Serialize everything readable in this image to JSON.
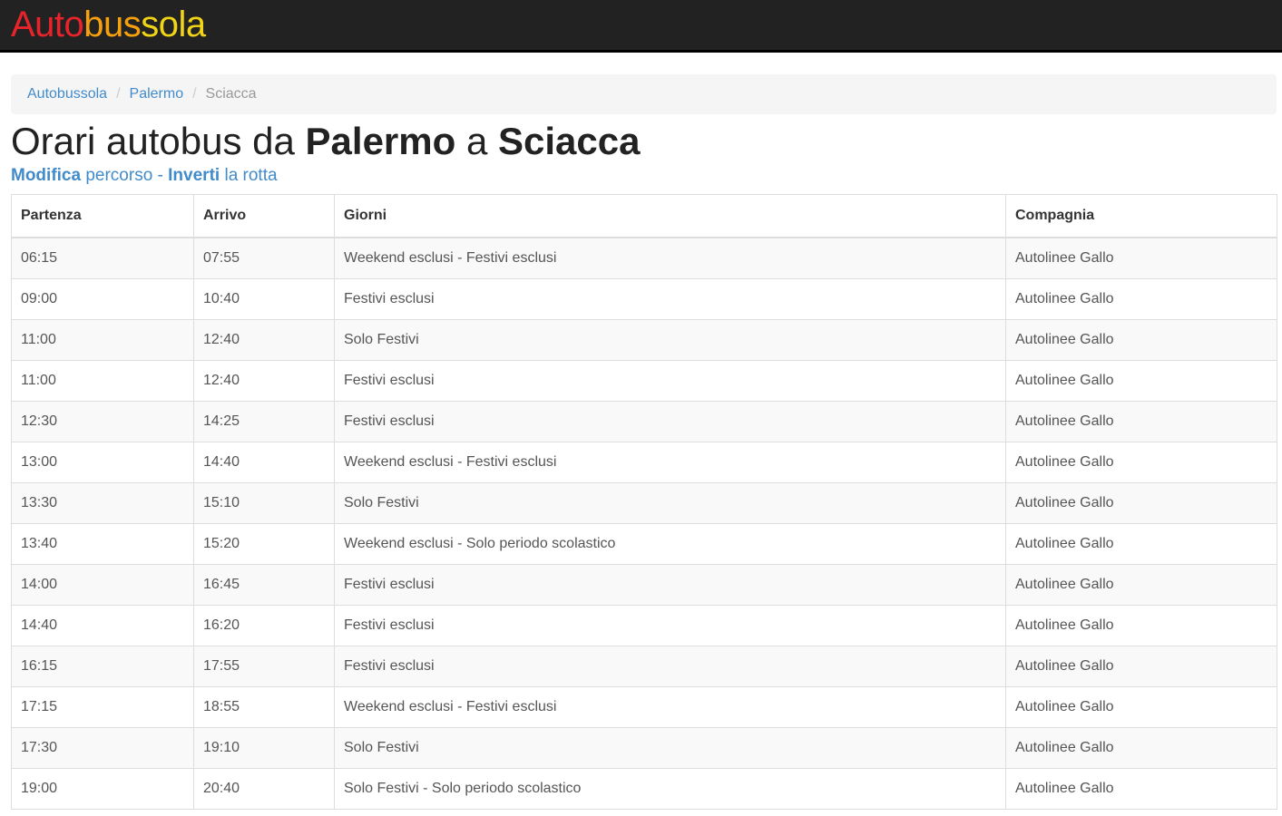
{
  "brand": {
    "part1": "Auto",
    "part2": "bus",
    "part3": "sola",
    "colors": {
      "red": "#e8232a",
      "orange": "#f5a00f",
      "yellow": "#f2d416"
    }
  },
  "breadcrumb": {
    "items": [
      "Autobussola",
      "Palermo"
    ],
    "current": "Sciacca"
  },
  "title": {
    "prefix": "Orari autobus da",
    "origin": "Palermo",
    "middle": "a",
    "destination": "Sciacca"
  },
  "route_links": {
    "modify_bold": "Modifica",
    "modify_rest": "percorso",
    "separator": "-",
    "invert_bold": "Inverti",
    "invert_rest": "la rotta"
  },
  "table": {
    "headers": [
      "Partenza",
      "Arrivo",
      "Giorni",
      "Compagnia"
    ],
    "rows": [
      [
        "06:15",
        "07:55",
        "Weekend esclusi - Festivi esclusi",
        "Autolinee Gallo"
      ],
      [
        "09:00",
        "10:40",
        "Festivi esclusi",
        "Autolinee Gallo"
      ],
      [
        "11:00",
        "12:40",
        "Solo Festivi",
        "Autolinee Gallo"
      ],
      [
        "11:00",
        "12:40",
        "Festivi esclusi",
        "Autolinee Gallo"
      ],
      [
        "12:30",
        "14:25",
        "Festivi esclusi",
        "Autolinee Gallo"
      ],
      [
        "13:00",
        "14:40",
        "Weekend esclusi - Festivi esclusi",
        "Autolinee Gallo"
      ],
      [
        "13:30",
        "15:10",
        "Solo Festivi",
        "Autolinee Gallo"
      ],
      [
        "13:40",
        "15:20",
        "Weekend esclusi - Solo periodo scolastico",
        "Autolinee Gallo"
      ],
      [
        "14:00",
        "16:45",
        "Festivi esclusi",
        "Autolinee Gallo"
      ],
      [
        "14:40",
        "16:20",
        "Festivi esclusi",
        "Autolinee Gallo"
      ],
      [
        "16:15",
        "17:55",
        "Festivi esclusi",
        "Autolinee Gallo"
      ],
      [
        "17:15",
        "18:55",
        "Weekend esclusi - Festivi esclusi",
        "Autolinee Gallo"
      ],
      [
        "17:30",
        "19:10",
        "Solo Festivi",
        "Autolinee Gallo"
      ],
      [
        "19:00",
        "20:40",
        "Solo Festivi - Solo periodo scolastico",
        "Autolinee Gallo"
      ]
    ]
  }
}
